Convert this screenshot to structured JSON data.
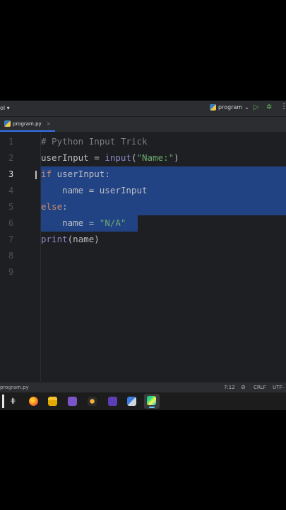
{
  "toolbar": {
    "project_fragment": "ol ▾",
    "run_config": "program",
    "run_config_arrow": "⌄"
  },
  "tabs": [
    {
      "label": "program.py",
      "close": "×"
    }
  ],
  "editor": {
    "line_numbers": [
      "1",
      "2",
      "3",
      "4",
      "5",
      "6",
      "7",
      "8",
      "9"
    ],
    "active_line": 3,
    "code": {
      "l1_comment": "# Python Input Trick",
      "l2_var": "userInput = ",
      "l2_fn": "input",
      "l2_open": "(",
      "l2_str": "\"Name:\"",
      "l2_close": ")",
      "l3_kw": "if",
      "l3_rest": " userInput:",
      "l4": "    name = userInput",
      "l5_kw": "else",
      "l5_colon": ":",
      "l6_code": "    name = ",
      "l6_str": "\"N/A\"",
      "l7_fn": "print",
      "l7_rest": "(name)"
    }
  },
  "status": {
    "file": "program.py",
    "position": "7:12",
    "line_ending": "CRLF",
    "encoding": "UTF-"
  },
  "taskbar": {
    "icons": [
      "task-view-icon",
      "firefox-icon",
      "file-explorer-icon",
      "visual-studio-icon",
      "ide-plugin-icon",
      "visual-studio-purple-icon",
      "app-icon",
      "pycharm-icon"
    ]
  },
  "colors": {
    "editor_bg": "#1e1f22",
    "selection": "#214283",
    "keyword": "#cf8e6d",
    "string": "#6aab73",
    "comment": "#7a7e85",
    "builtin": "#8888c6",
    "accent": "#3574f0"
  }
}
